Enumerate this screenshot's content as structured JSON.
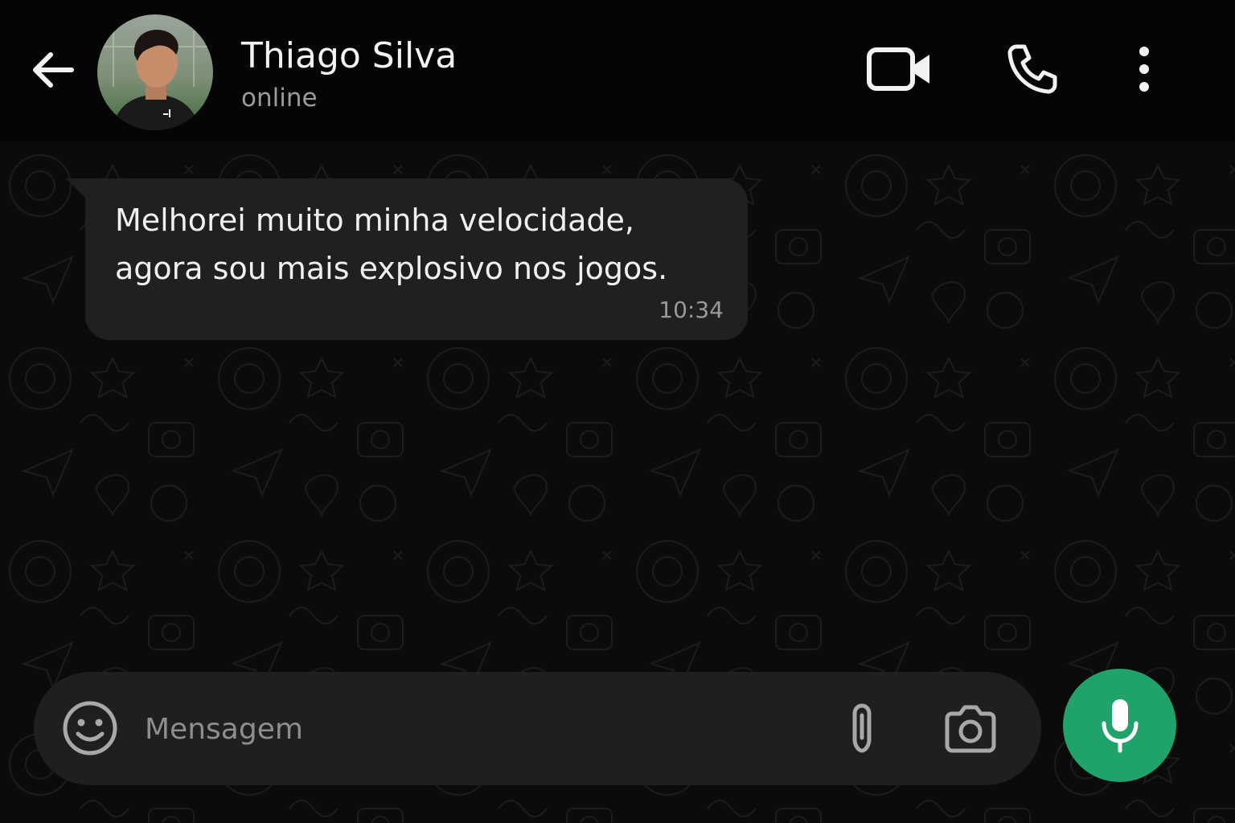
{
  "header": {
    "back_icon": "arrow-left-icon",
    "contact_name": "Thiago Silva",
    "contact_status": "online",
    "video_icon": "video-camera-icon",
    "call_icon": "phone-icon",
    "more_icon": "more-vertical-icon"
  },
  "messages": [
    {
      "direction": "incoming",
      "lines": [
        "Melhorei muito minha velocidade,",
        "agora sou mais explosivo nos jogos."
      ],
      "time": "10:34"
    }
  ],
  "composer": {
    "emoji_icon": "smiley-icon",
    "placeholder": "Mensagem",
    "value": "",
    "attach_icon": "paperclip-icon",
    "camera_icon": "camera-icon",
    "mic_icon": "microphone-icon"
  },
  "colors": {
    "background": "#0b0b0b",
    "header": "#050505",
    "bubble": "#202020",
    "input_bar": "#1f1f1f",
    "accent": "#1fa36b",
    "status_text": "#9b9b9b"
  }
}
